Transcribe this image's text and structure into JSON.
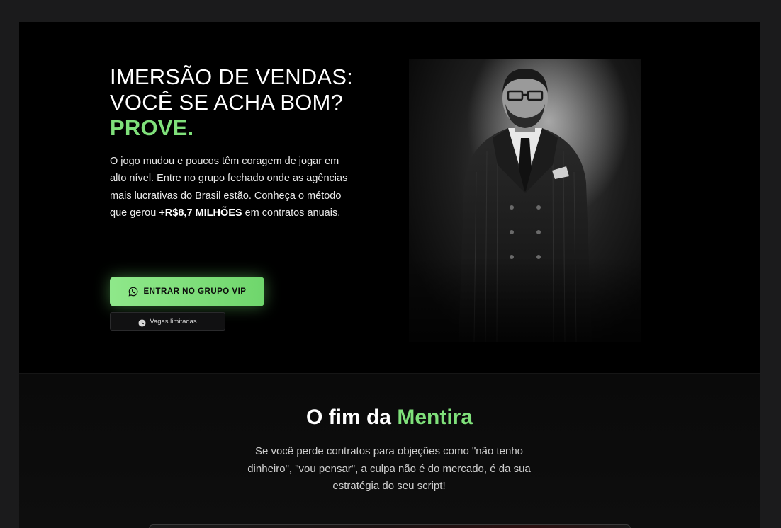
{
  "hero": {
    "title_line1": "IMERSÃO DE VENDAS:",
    "title_line2": "VOCÊ SE ACHA BOM?",
    "title_accent": "PROVE.",
    "text_before": "O jogo mudou e poucos têm coragem de jogar em alto nível. Entre no grupo fechado onde as agências mais lucrativas do Brasil estão. Conheça o método que gerou ",
    "text_highlight": "+R$8,7 MILHÕES",
    "text_after": " em contratos anuais.",
    "cta_label": "ENTRAR NO GRUPO VIP",
    "cta_icon": "whatsapp-icon",
    "badge_label": "Vagas limitadas",
    "badge_icon": "clock-icon"
  },
  "section2": {
    "title_prefix": "O fim da ",
    "title_accent": "Mentira",
    "text": "Se você perde contratos para objeções como \"não tenho dinheiro\", \"vou pensar\", a culpa não é do mercado, é da sua estratégia do seu script!"
  },
  "colors": {
    "accent": "#7fe07a",
    "background": "#000000",
    "outer_background": "#1b1b1c"
  }
}
